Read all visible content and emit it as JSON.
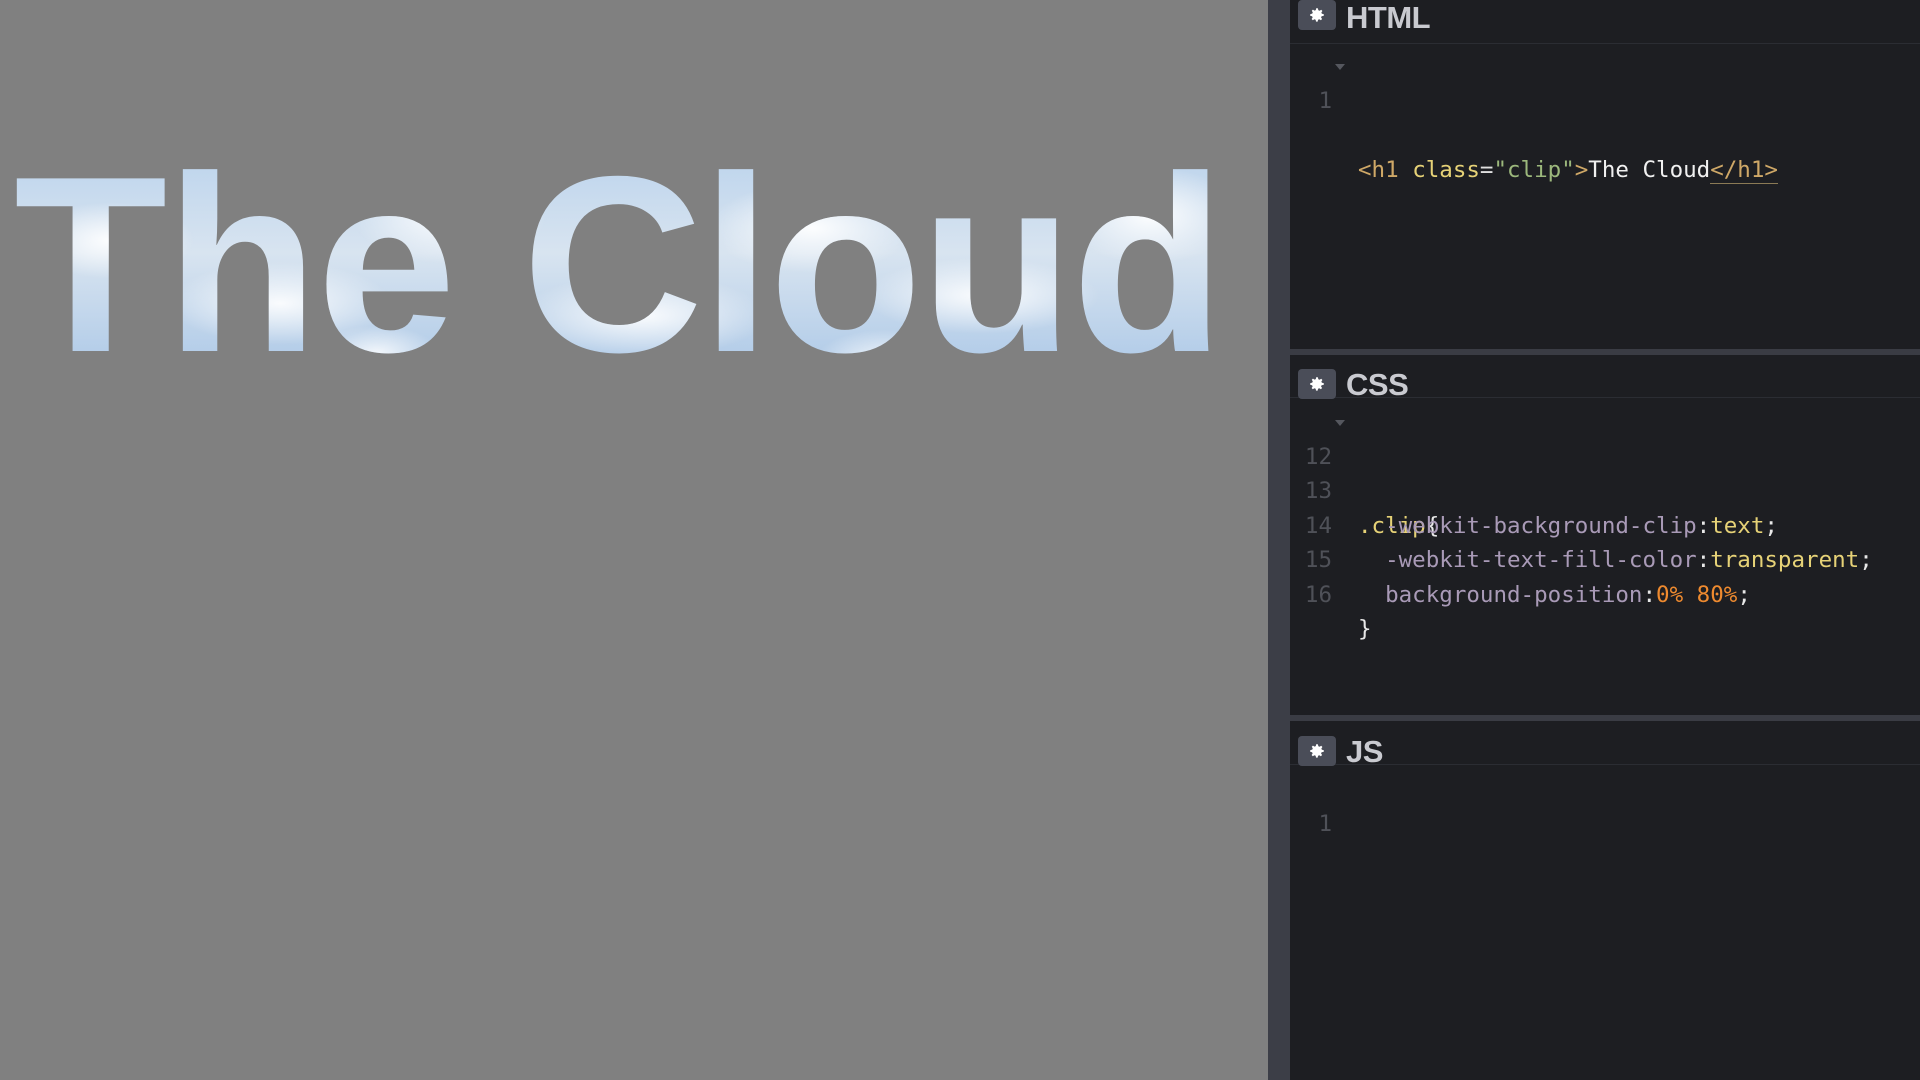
{
  "preview": {
    "heading": "The Cloud"
  },
  "editor": {
    "html_pane": {
      "title": "HTML",
      "lines": [
        {
          "number": "1",
          "tag_open": "<h1",
          "attr": "class",
          "eq": "=",
          "value": "\"clip\"",
          "tag_end": ">",
          "text": "The Cloud",
          "close": "</h1>"
        }
      ]
    },
    "css_pane": {
      "title": "CSS",
      "lines": [
        {
          "number": "12",
          "selector": ".clip",
          "brace": "{"
        },
        {
          "number": "13",
          "prop": "-webkit-background-clip",
          "colon": ":",
          "value": "text",
          "semi": ";"
        },
        {
          "number": "14",
          "prop": "-webkit-text-fill-color",
          "colon": ":",
          "value": "transparent",
          "semi": ";"
        },
        {
          "number": "15",
          "prop": "background-position",
          "colon": ":",
          "value_a": "0%",
          "space": " ",
          "value_b": "80%",
          "semi": ";"
        },
        {
          "number": "16",
          "brace": "}"
        }
      ]
    },
    "js_pane": {
      "title": "JS",
      "lines": [
        {
          "number": "1"
        }
      ]
    }
  },
  "colors": {
    "preview_bg": "#808080",
    "editor_bg": "#1d1e22",
    "divider": "#3a3c44",
    "keyword_yellow": "#e6d277",
    "number_orange": "#ee8a2f",
    "property_purple": "#a99ab7",
    "string_green": "#9cb87c"
  },
  "icons": {
    "pane_settings": "gear-icon",
    "fold_marker": "fold-triangle-icon"
  }
}
